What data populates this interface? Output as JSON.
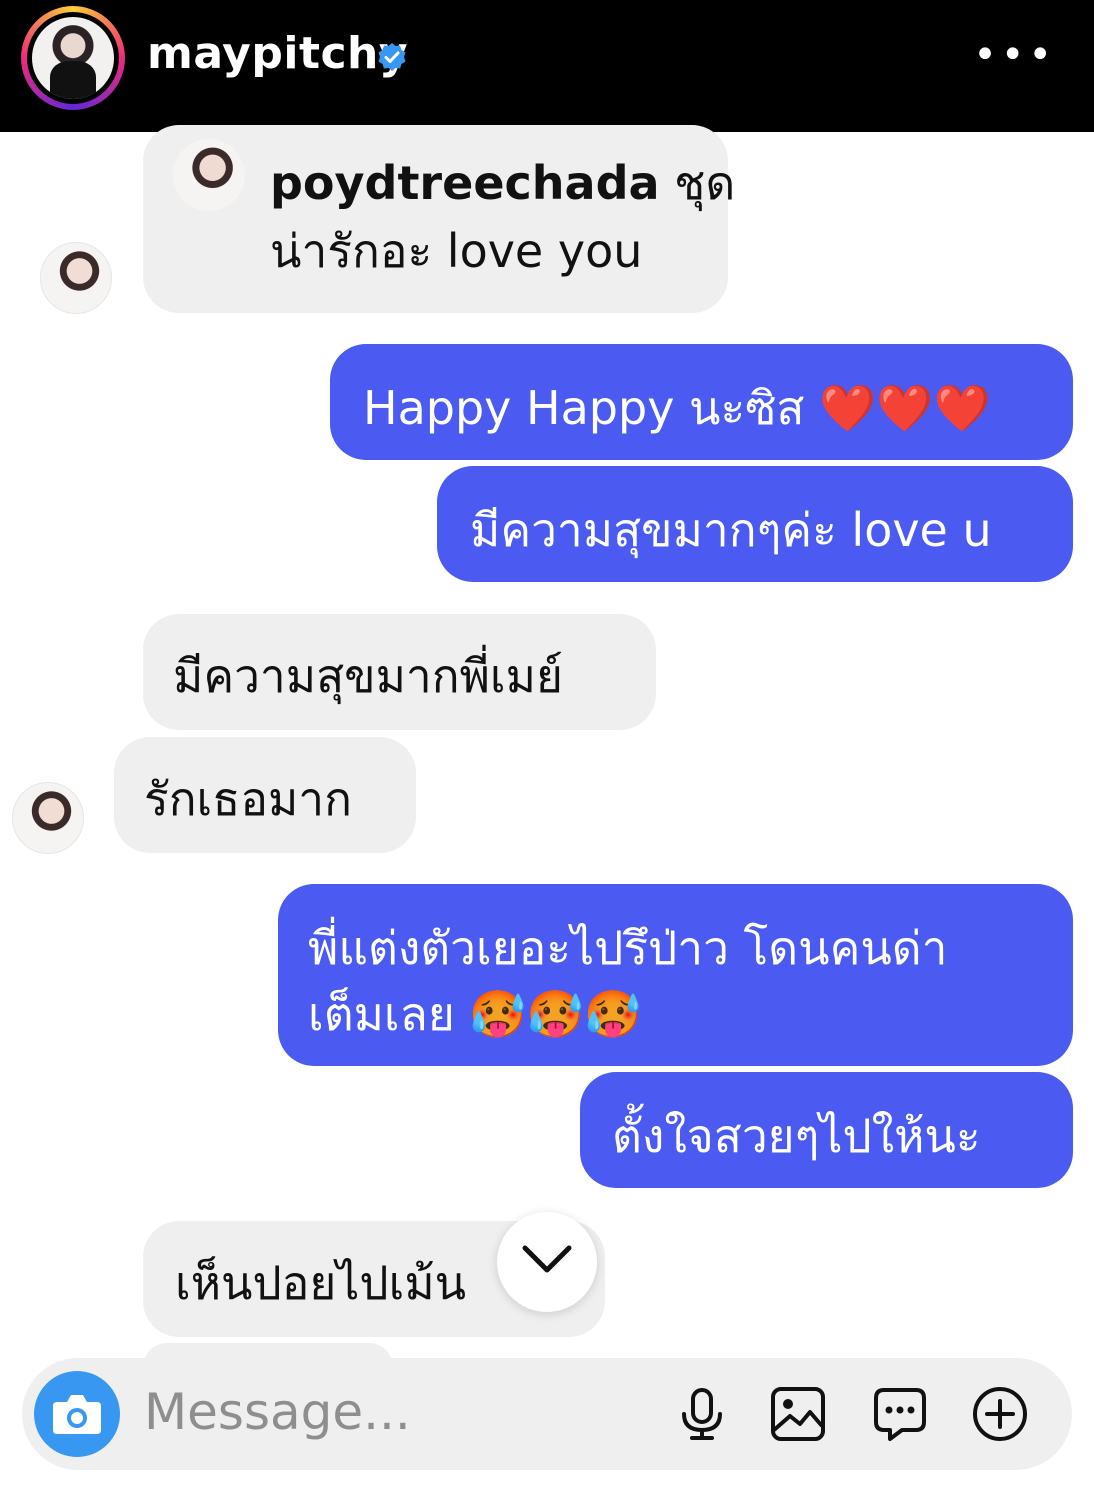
{
  "header": {
    "username": "maypitchy",
    "icons": [
      "verified-badge-icon",
      "more-icon"
    ],
    "colors": {
      "background": "#000000",
      "verified": "#3897f0"
    }
  },
  "messages": [
    {
      "direction": "incoming",
      "reply_user": "poydtreechada",
      "text_line1": "ชุด",
      "text_line2": "น่ารักอะ love you"
    },
    {
      "direction": "outgoing",
      "text": "Happy Happy นะซิส ❤️❤️❤️"
    },
    {
      "direction": "outgoing",
      "text": "มีความสุขมากๆค่ะ love u"
    },
    {
      "direction": "incoming",
      "text": "มีความสุขมากพี่เมย์"
    },
    {
      "direction": "incoming",
      "text": "รักเธอมาก"
    },
    {
      "direction": "outgoing",
      "text_line1": "พี่แต่งตัวเยอะไปรึป่าว โดนคนด่า",
      "text_line2": "เต็มเลย 🥵🥵🥵"
    },
    {
      "direction": "outgoing",
      "text": "ตั้งใจสวยๆไปให้นะ"
    },
    {
      "direction": "incoming",
      "text": "เห็นปอยไปเม้น"
    }
  ],
  "composer": {
    "placeholder": "Message...",
    "icons": [
      "camera-icon",
      "microphone-icon",
      "gallery-icon",
      "sticker-icon",
      "plus-icon"
    ]
  },
  "colors": {
    "outgoing_bubble": "#4b5af0",
    "incoming_bubble": "#efefef",
    "camera_button": "#3897f0"
  }
}
